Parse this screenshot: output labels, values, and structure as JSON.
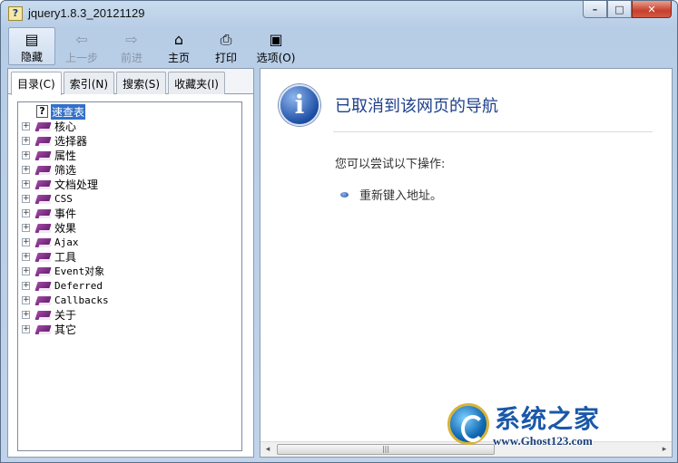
{
  "window": {
    "title": "jquery1.8.3_20121129"
  },
  "toolbar": {
    "hide_label": "隐藏",
    "back_label": "上一步",
    "forward_label": "前进",
    "home_label": "主页",
    "print_label": "打印",
    "options_label": "选项(O)"
  },
  "tabs": [
    {
      "label": "目录(C)"
    },
    {
      "label": "索引(N)"
    },
    {
      "label": "搜索(S)"
    },
    {
      "label": "收藏夹(I)"
    }
  ],
  "tree": {
    "items": [
      {
        "label": "速查表"
      },
      {
        "label": "核心"
      },
      {
        "label": "选择器"
      },
      {
        "label": "属性"
      },
      {
        "label": "筛选"
      },
      {
        "label": "文档处理"
      },
      {
        "label": "CSS"
      },
      {
        "label": "事件"
      },
      {
        "label": "效果"
      },
      {
        "label": "Ajax"
      },
      {
        "label": "工具"
      },
      {
        "label": "Event对象"
      },
      {
        "label": "Deferred"
      },
      {
        "label": "Callbacks"
      },
      {
        "label": "关于"
      },
      {
        "label": "其它"
      }
    ]
  },
  "content": {
    "title": "已取消到该网页的导航",
    "hint": "您可以尝试以下操作:",
    "suggestion": "重新键入地址。"
  },
  "watermark": {
    "brand": "系统之家",
    "url": "www.Ghost123.com"
  },
  "icons": {
    "title": "help-book-icon",
    "hide": "hide-pane-icon",
    "back": "back-arrow-icon",
    "forward": "forward-arrow-icon",
    "home": "home-icon",
    "print": "printer-icon",
    "options": "options-icon",
    "info": "info-icon",
    "book": "book-icon",
    "help": "question-page-icon"
  },
  "colors": {
    "accent": "#1d3f8a",
    "selection": "#3370c9",
    "book": "#8a2f92"
  }
}
